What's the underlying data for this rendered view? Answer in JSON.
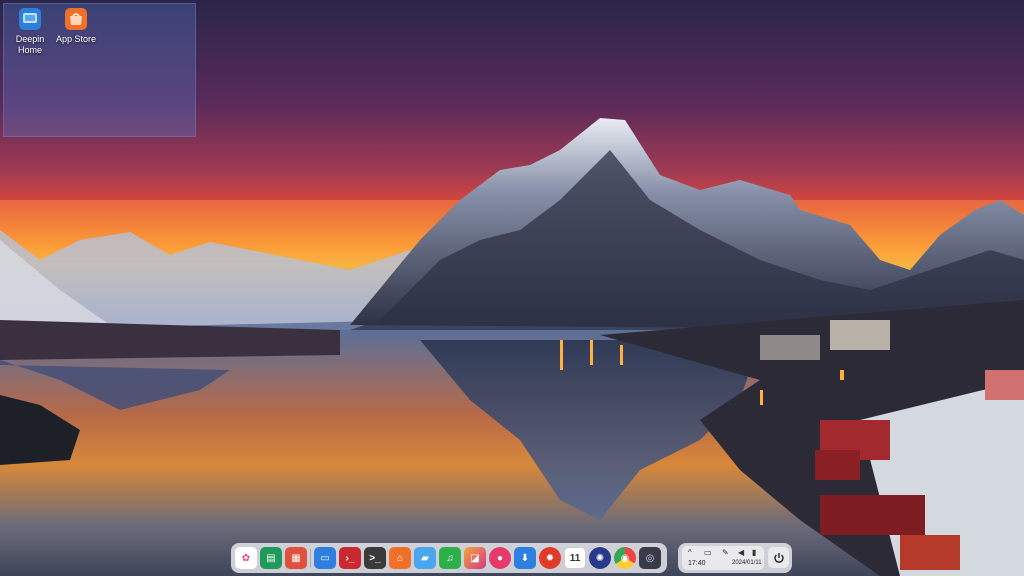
{
  "desktop": {
    "icons": [
      {
        "label_line1": "Deepin",
        "label_line2": "Home",
        "icon": "deepin-home-icon"
      },
      {
        "label_line1": "App Store",
        "label_line2": "",
        "icon": "app-store-icon"
      }
    ]
  },
  "dock": {
    "apps": [
      {
        "name": "launcher-icon",
        "glyph": "✿"
      },
      {
        "name": "file-manager-icon",
        "glyph": "▤"
      },
      {
        "name": "multitask-icon",
        "glyph": "▦"
      },
      {
        "name": "browser-window-icon",
        "glyph": "▭"
      },
      {
        "name": "terminal-red-icon",
        "glyph": "›_"
      },
      {
        "name": "terminal-icon",
        "glyph": ">_"
      },
      {
        "name": "app-store-icon",
        "glyph": "⌂"
      },
      {
        "name": "folder-icon",
        "glyph": "▰"
      },
      {
        "name": "music-icon",
        "glyph": "♫"
      },
      {
        "name": "image-viewer-icon",
        "glyph": "◪"
      },
      {
        "name": "screen-recorder-icon",
        "glyph": "●"
      },
      {
        "name": "download-icon",
        "glyph": "⬇"
      },
      {
        "name": "settings-icon",
        "glyph": "✹"
      },
      {
        "name": "calendar-icon",
        "glyph": "11"
      },
      {
        "name": "help-icon",
        "glyph": "✺"
      },
      {
        "name": "chrome-icon",
        "glyph": "◉"
      },
      {
        "name": "camera-icon",
        "glyph": "◎"
      }
    ]
  },
  "tray": {
    "time": "17:40",
    "date": "2024/01/11",
    "icons": [
      "chevron-up-icon",
      "notification-icon",
      "pen-icon",
      "volume-icon",
      "battery-icon"
    ]
  }
}
